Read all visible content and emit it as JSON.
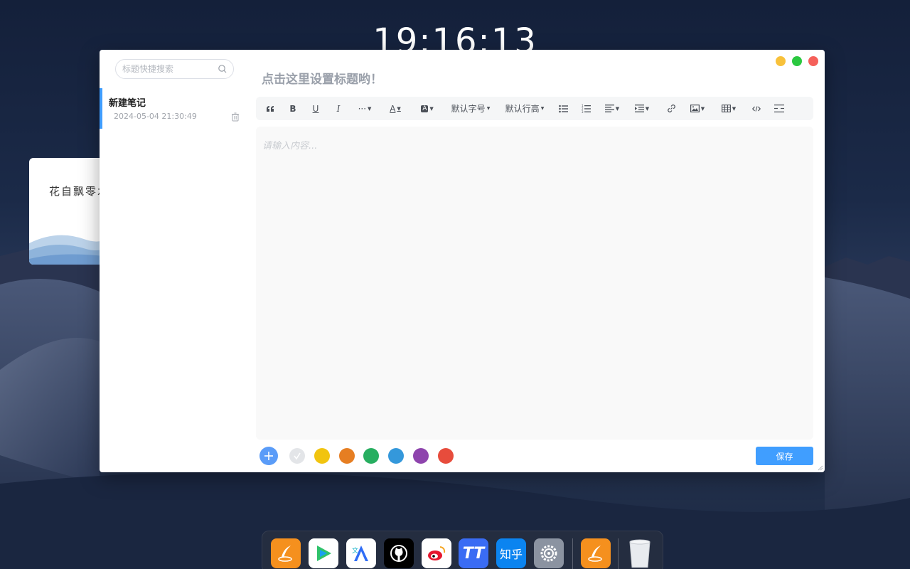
{
  "clock": {
    "time": "19:16:13"
  },
  "widget": {
    "text": "花自飘零水"
  },
  "sidebar": {
    "search": {
      "placeholder": "标题快捷搜索",
      "value": ""
    },
    "notes": [
      {
        "title": "新建笔记",
        "date": "2024-05-04 21:30:49",
        "selected": true
      }
    ]
  },
  "editor": {
    "title_placeholder": "点击这里设置标题哟！",
    "content_placeholder": "请输入内容...",
    "toolbar": {
      "quote": "quote-icon",
      "bold": "B",
      "underline": "U",
      "italic": "I",
      "more": "···",
      "font_color": "A",
      "bg_color": "A",
      "font_size": "默认字号",
      "line_height": "默认行高",
      "bullet_list": "bullet-list-icon",
      "ordered_list": "ordered-list-icon",
      "align": "align-icon",
      "indent": "indent-icon",
      "link": "link-icon",
      "image": "image-icon",
      "table": "table-icon",
      "code": "code-icon",
      "divider": "divider-icon"
    }
  },
  "footer": {
    "add_icon": "plus-icon",
    "colors": [
      "#e3e5e8",
      "#f1c40f",
      "#e67e22",
      "#27ae60",
      "#3498db",
      "#8e44ad",
      "#e74c3c"
    ],
    "save_label": "保存"
  },
  "window_controls": {
    "minimize": "#f8c13a",
    "maximize": "#2bc840",
    "close": "#f5605a"
  },
  "dock": {
    "apps": [
      {
        "name": "notes-app-icon"
      },
      {
        "name": "video-player-icon"
      },
      {
        "name": "translate-icon"
      },
      {
        "name": "github-icon"
      },
      {
        "name": "weibo-icon"
      },
      {
        "name": "typora-tt-icon",
        "label": "TT"
      },
      {
        "name": "zhihu-icon",
        "label": "知乎"
      },
      {
        "name": "settings-icon"
      },
      {
        "name": "notes-app-icon"
      },
      {
        "name": "trash-bin-icon"
      }
    ]
  }
}
